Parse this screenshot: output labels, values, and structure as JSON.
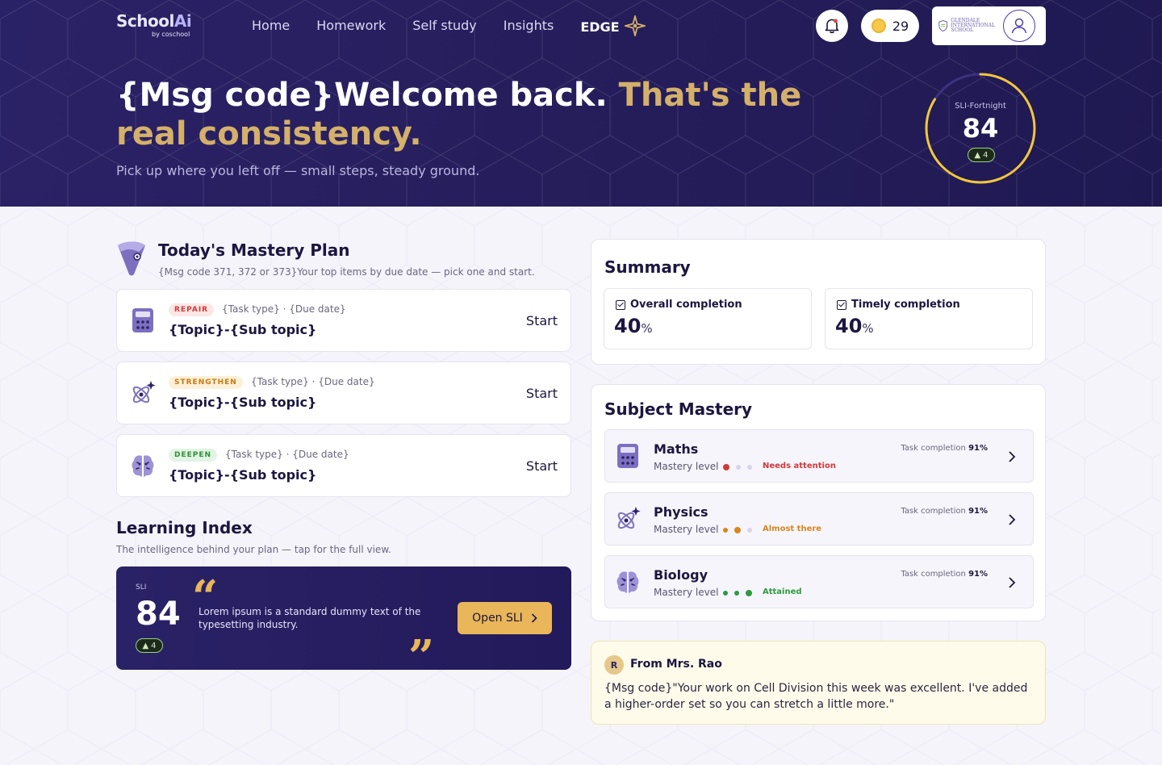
{
  "header": {
    "brand_main": "School",
    "brand_ai": "Ai",
    "brand_by": "by coschool",
    "nav": [
      "Home",
      "Homework",
      "Self study",
      "Insights",
      "EDGE"
    ],
    "coins": "29",
    "school_name_line1": "GLENDALE",
    "school_name_line2": "INTERNATIONAL",
    "school_name_line3": "SCHOOL"
  },
  "hero": {
    "title_white": "{Msg code}Welcome back. ",
    "title_gold": "That's the real consistency.",
    "subtitle": "Pick up where you left off — small steps, steady ground.",
    "sli_label": "SLI-Fortnight",
    "sli_value": "84",
    "sli_delta": "4",
    "sli_progress": 0.84
  },
  "plan": {
    "title": "Today's Mastery Plan",
    "subtitle": "{Msg code 371, 372 or 373}Your top items by due date — pick one and start.",
    "tasks": [
      {
        "tag": "REPAIR",
        "meta": "{Task type} · {Due date}",
        "topic": "{Topic}-{Sub topic}",
        "action": "Start"
      },
      {
        "tag": "STRENGTHEN",
        "meta": "{Task type} · {Due date}",
        "topic": "{Topic}-{Sub topic}",
        "action": "Start"
      },
      {
        "tag": "DEEPEN",
        "meta": "{Task type} · {Due date}",
        "topic": "{Topic}-{Sub topic}",
        "action": "Start"
      }
    ]
  },
  "learning_index": {
    "title": "Learning Index",
    "subtitle": "The intelligence behind your plan — tap for the full view.",
    "sli_label": "SLI",
    "sli_value": "84",
    "sli_delta": "4",
    "quote_open": "“",
    "quote_close": "”",
    "text": "Lorem ipsum is a standard dummy text of the typesetting industry.",
    "button": "Open SLI"
  },
  "summary": {
    "title": "Summary",
    "overall_label": "Overall completion",
    "overall_value": "40",
    "timely_label": "Timely completion",
    "timely_value": "40",
    "unit": "%"
  },
  "mastery": {
    "title": "Subject Mastery",
    "mastery_label": "Mastery level",
    "tc_label": "Task completion",
    "subjects": [
      {
        "name": "Maths",
        "status": "Needs attention",
        "tc": "91%",
        "color": "#d13a3a",
        "level": 1
      },
      {
        "name": "Physics",
        "status": "Almost there",
        "tc": "91%",
        "color": "#d9851c",
        "level": 2
      },
      {
        "name": "Biology",
        "status": "Attained",
        "tc": "91%",
        "color": "#2f9a3f",
        "level": 3
      }
    ]
  },
  "note": {
    "initial": "R",
    "from": "From Mrs. Rao",
    "message": "{Msg code}\"Your work on Cell Division this week was excellent. I've added a higher-order set so you can stretch a little more.\""
  }
}
